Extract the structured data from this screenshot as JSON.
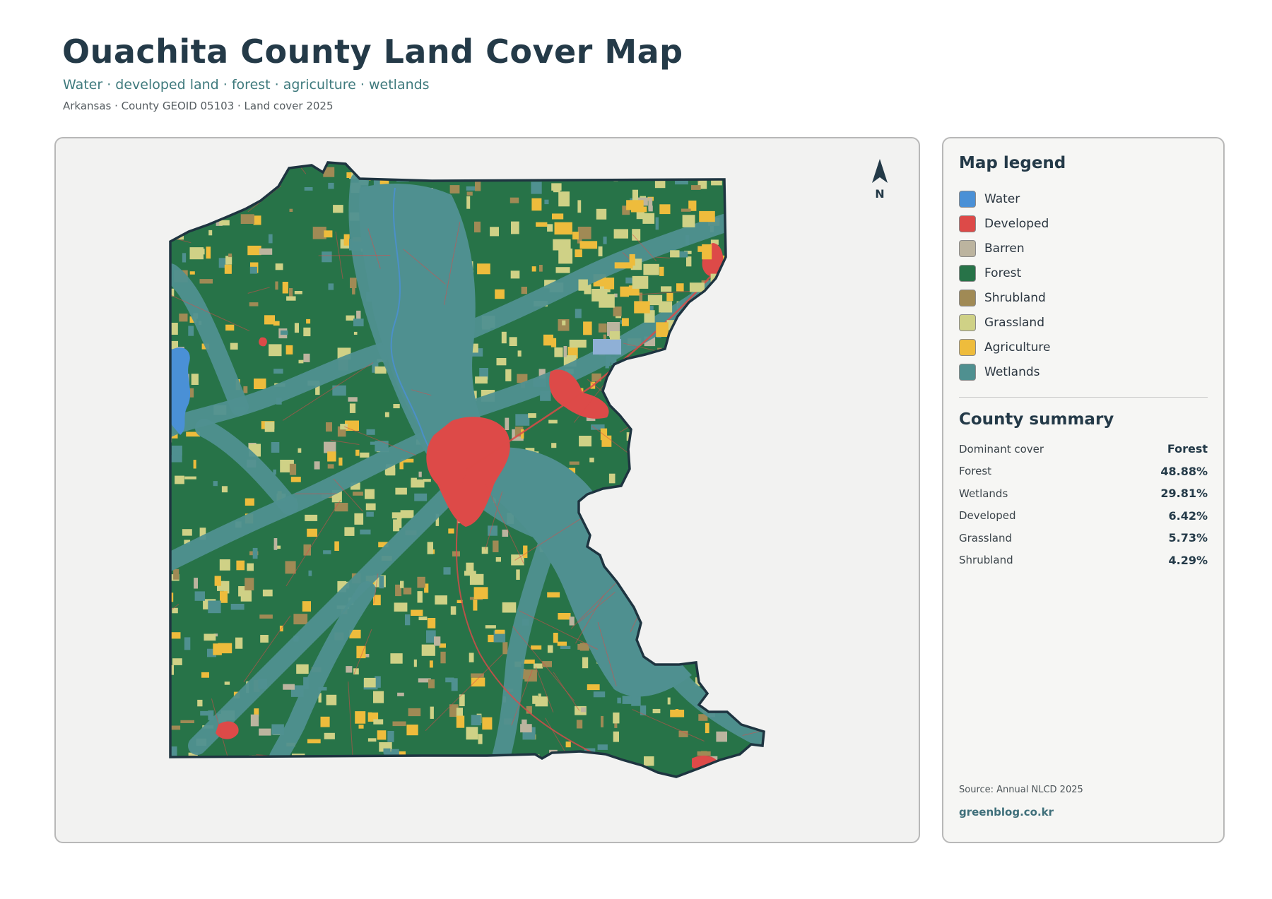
{
  "header": {
    "title": "Ouachita County Land Cover Map",
    "subtitle": "Water · developed land · forest · agriculture · wetlands",
    "meta": "Arkansas · County GEOID 05103 · Land cover 2025"
  },
  "map": {
    "north_label": "N",
    "colors": {
      "water": "#4a90d6",
      "developed": "#dd4a48",
      "barren": "#bcb49f",
      "forest": "#277348",
      "shrubland": "#a08a55",
      "grassland": "#cfd186",
      "agriculture": "#eebc3c",
      "wetlands": "#4f9090",
      "border": "#1e3440"
    }
  },
  "legend": {
    "title": "Map legend",
    "items": [
      {
        "label": "Water",
        "color": "#4a90d6"
      },
      {
        "label": "Developed",
        "color": "#dd4a48"
      },
      {
        "label": "Barren",
        "color": "#bcb49f"
      },
      {
        "label": "Forest",
        "color": "#277348"
      },
      {
        "label": "Shrubland",
        "color": "#a08a55"
      },
      {
        "label": "Grassland",
        "color": "#cfd186"
      },
      {
        "label": "Agriculture",
        "color": "#eebc3c"
      },
      {
        "label": "Wetlands",
        "color": "#4f9090"
      }
    ]
  },
  "summary": {
    "title": "County summary",
    "rows": [
      {
        "key": "Dominant cover",
        "value": "Forest"
      },
      {
        "key": "Forest",
        "value": "48.88%"
      },
      {
        "key": "Wetlands",
        "value": "29.81%"
      },
      {
        "key": "Developed",
        "value": "6.42%"
      },
      {
        "key": "Grassland",
        "value": "5.73%"
      },
      {
        "key": "Shrubland",
        "value": "4.29%"
      }
    ]
  },
  "footer": {
    "source": "Source: Annual NLCD 2025",
    "site": "greenblog.co.kr"
  }
}
